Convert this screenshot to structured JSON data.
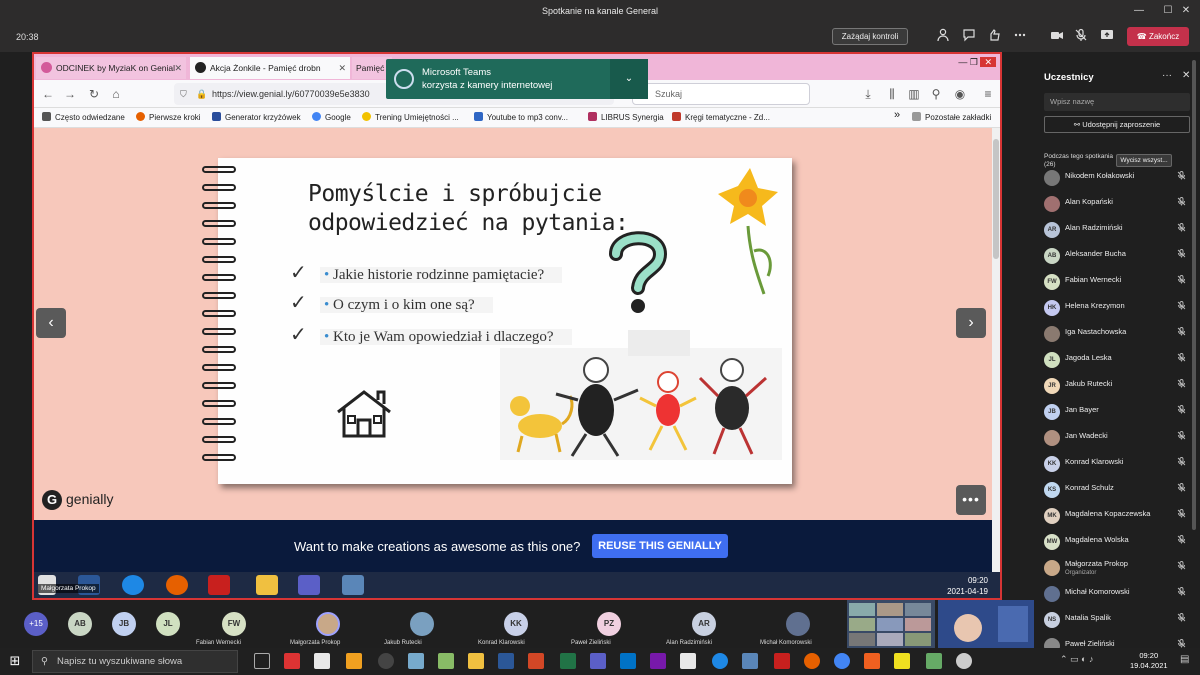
{
  "teams": {
    "window_title": "Spotkanie na kanale General",
    "win_min": "—",
    "win_max": "☐",
    "win_close": "✕",
    "meeting_time": "20:38",
    "request_control": "Zażądaj kontroli",
    "end_call": "Zakończ",
    "accent": "#5b5fc7",
    "end_color": "#c4314b"
  },
  "browser": {
    "tabs": [
      {
        "label": "ODCINEK by MyziaK on Genial",
        "close": "✕"
      },
      {
        "label": "Akcja Żonkile - Pamięć drobn",
        "close": "✕"
      },
      {
        "label": "Pamięć"
      }
    ],
    "url": "https://view.genial.ly/60770039e5e3830",
    "search_placeholder": "Szukaj",
    "bookmarks": [
      {
        "label": "Często odwiedzane",
        "color": "#555"
      },
      {
        "label": "Pierwsze kroki",
        "color": "#e66000"
      },
      {
        "label": "Generator krzyżówek",
        "color": "#2a4d9b"
      },
      {
        "label": "Google",
        "color": "#4285f4"
      },
      {
        "label": "Trening Umiejętności ...",
        "color": "#f2c200"
      },
      {
        "label": "Youtube to mp3 conv...",
        "color": "#2f66c4"
      },
      {
        "label": "LIBRUS Synergia",
        "color": "#b03060"
      },
      {
        "label": "Kręgi tematyczne - Zd...",
        "color": "#c0392b"
      }
    ],
    "more_bookmarks": "»",
    "other_bookmarks": "Pozostałe zakładki"
  },
  "slide": {
    "title_line1": "Pomyślcie i spróbujcie",
    "title_line2": "odpowiedzieć na pytania:",
    "questions": [
      "Jakie historie rodzinne pamiętacie?",
      "O czym i o kim one są?",
      "Kto je Wam opowiedział i dlaczego?"
    ],
    "logo_text": "genially",
    "logo_letter": "G",
    "prev_arrow": "‹",
    "next_arrow": "›",
    "more": "•••",
    "promo_text": "Want to make creations as awesome as this one?",
    "reuse_button": "REUSE THIS GENIALLY"
  },
  "inner_taskbar": {
    "presenter": "Małgorzata Prokop",
    "time": "09:20",
    "date": "2021-04-19"
  },
  "toast": {
    "line1": "Microsoft Teams",
    "line2": "korzysta z kamery internetowej",
    "chevron": "⌄"
  },
  "participants": {
    "title": "Uczestnicy",
    "more": "···",
    "close": "✕",
    "search_placeholder": "Wpisz nazwę",
    "share_invite": "Udostępnij zaproszenie",
    "during_label": "Podczas tego spotkania (26)",
    "mute_all": "Wycisz wszyst...",
    "people": [
      {
        "initials": "",
        "name": "Nikodem Kołakowski",
        "color": "#777"
      },
      {
        "initials": "",
        "name": "Alan Kopański",
        "color": "#a07070"
      },
      {
        "initials": "AR",
        "name": "Alan Radzimiński",
        "color": "#b8c4d8"
      },
      {
        "initials": "AB",
        "name": "Aleksander Bucha",
        "color": "#c9d6c4"
      },
      {
        "initials": "FW",
        "name": "Fabian Wernecki",
        "color": "#d6e0c4"
      },
      {
        "initials": "HK",
        "name": "Helena Krezymon",
        "color": "#c4c8f0"
      },
      {
        "initials": "",
        "name": "Iga Nastachowska",
        "color": "#8a7a70"
      },
      {
        "initials": "JL",
        "name": "Jagoda Leska",
        "color": "#d0e0c0"
      },
      {
        "initials": "JR",
        "name": "Jakub Rutecki",
        "color": "#f0d8b8"
      },
      {
        "initials": "JB",
        "name": "Jan Bayer",
        "color": "#c0d0f0"
      },
      {
        "initials": "",
        "name": "Jan Wadecki",
        "color": "#b09080"
      },
      {
        "initials": "KK",
        "name": "Konrad Klarowski",
        "color": "#c8d0e8"
      },
      {
        "initials": "KS",
        "name": "Konrad Schulz",
        "color": "#c0d8f0"
      },
      {
        "initials": "MK",
        "name": "Magdalena Kopaczewska",
        "color": "#e0d0c0"
      },
      {
        "initials": "MW",
        "name": "Magdalena Wolska",
        "color": "#d8e0c8"
      },
      {
        "initials": "",
        "name": "Małgorzata Prokop",
        "role": "Organizator",
        "color": "#c8a888"
      },
      {
        "initials": "",
        "name": "Michał Komorowski",
        "color": "#607090"
      },
      {
        "initials": "NS",
        "name": "Natalia Spalik",
        "color": "#c8d0e0"
      },
      {
        "initials": "",
        "name": "Paweł Zieliński",
        "color": "#888"
      }
    ]
  },
  "strip": {
    "overflow": "+15",
    "avatars": [
      {
        "initials": "AB",
        "color": "#c9d6c4"
      },
      {
        "initials": "JB",
        "color": "#c0d0f0"
      },
      {
        "initials": "JL",
        "color": "#d0e0c0"
      }
    ],
    "named": [
      {
        "initials": "FW",
        "name": "Fabian Wernecki",
        "color": "#d6e0c4"
      },
      {
        "initials": "",
        "name": "Małgorzata Prokop",
        "color": "#c8a888"
      },
      {
        "initials": "",
        "name": "Jakub Rutecki",
        "color": "#7aa0c0"
      },
      {
        "initials": "KK",
        "name": "Konrad Klarowski",
        "color": "#c8d0e8"
      },
      {
        "initials": "PZ",
        "name": "Paweł Zieliński",
        "color": "#f0d0e0"
      },
      {
        "initials": "AR",
        "name": "Alan Radzimiński",
        "color": "#c8d0e0"
      },
      {
        "initials": "",
        "name": "Michał Komorowski",
        "color": "#607090"
      }
    ]
  },
  "windows": {
    "start": "⊞",
    "search_placeholder": "Napisz tu wyszukiwane słowa",
    "time": "09:20",
    "date": "19.04.2021"
  }
}
